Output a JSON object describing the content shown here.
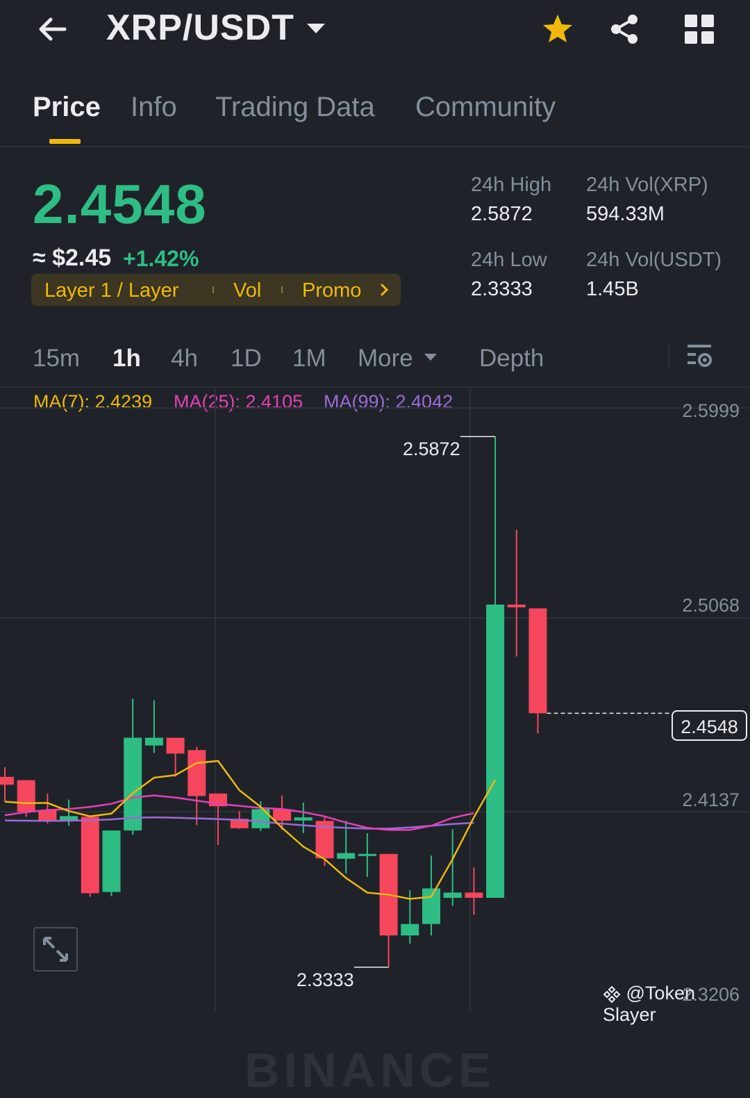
{
  "header": {
    "pair": "XRP/USDT",
    "icons": [
      "back-arrow-icon",
      "caret-down-icon",
      "star-icon",
      "share-icon",
      "grid-icon"
    ]
  },
  "tabs": [
    {
      "label": "Price",
      "active": true
    },
    {
      "label": "Info"
    },
    {
      "label": "Trading Data"
    },
    {
      "label": "Community"
    }
  ],
  "ticker": {
    "price": "2.4548",
    "usd": "≈ $2.45",
    "change": "+1.42%",
    "tags": [
      "Layer 1 / Layer",
      "Vol",
      "Promo"
    ],
    "stats": {
      "high_label": "24h High",
      "high": "2.5872",
      "low_label": "24h Low",
      "low": "2.3333",
      "vol_xrp_label": "24h Vol(XRP)",
      "vol_xrp": "594.33M",
      "vol_usdt_label": "24h Vol(USDT)",
      "vol_usdt": "1.45B"
    }
  },
  "intervals": {
    "items": [
      "15m",
      "1h",
      "4h",
      "1D",
      "1M",
      "More",
      "Depth"
    ],
    "active": "1h"
  },
  "indicators": {
    "ma7": "MA(7): 2.4239",
    "ma25": "MA(25): 2.4105",
    "ma99": "MA(99): 2.4042"
  },
  "colors": {
    "up": "#2ebd85",
    "down": "#f6465d",
    "accent": "#f0b90b",
    "ma7": "#f0b90b",
    "ma25": "#e440b6",
    "ma99": "#9c6ad8"
  },
  "chart_data": {
    "type": "candlestick",
    "y_axis_labels": [
      "2.5999",
      "2.5068",
      "2.4137",
      "2.3206"
    ],
    "ylim": [
      2.3206,
      2.5999
    ],
    "current_price": "2.4548",
    "high_marker": "2.5872",
    "low_marker": "2.3333",
    "watermark": "BINANCE",
    "candles": [
      {
        "o": 2.4244,
        "c": 2.4206,
        "h": 2.429,
        "l": 2.4125
      },
      {
        "o": 2.4228,
        "c": 2.4076,
        "h": 2.4228,
        "l": 2.4053
      },
      {
        "o": 2.4086,
        "c": 2.4033,
        "h": 2.4164,
        "l": 2.402
      },
      {
        "o": 2.4033,
        "c": 2.4056,
        "h": 2.4135,
        "l": 2.401
      },
      {
        "o": 2.4053,
        "c": 2.3687,
        "h": 2.4053,
        "l": 2.367
      },
      {
        "o": 2.3693,
        "c": 2.3987,
        "h": 2.3987,
        "l": 2.3673
      },
      {
        "o": 2.3987,
        "c": 2.4431,
        "h": 2.4617,
        "l": 2.3967
      },
      {
        "o": 2.4394,
        "c": 2.4431,
        "h": 2.461,
        "l": 2.4358
      },
      {
        "o": 2.4431,
        "c": 2.4355,
        "h": 2.4431,
        "l": 2.4244
      },
      {
        "o": 2.4372,
        "c": 2.4152,
        "h": 2.4387,
        "l": 2.4013
      },
      {
        "o": 2.4164,
        "c": 2.4103,
        "h": 2.4164,
        "l": 2.3918
      },
      {
        "o": 2.4043,
        "c": 2.3998,
        "h": 2.408,
        "l": 2.3995
      },
      {
        "o": 2.3998,
        "c": 2.4089,
        "h": 2.4127,
        "l": 2.3985
      },
      {
        "o": 2.4089,
        "c": 2.4034,
        "h": 2.4154,
        "l": 2.399
      },
      {
        "o": 2.4035,
        "c": 2.405,
        "h": 2.4121,
        "l": 2.3975
      },
      {
        "o": 2.4033,
        "c": 2.3854,
        "h": 2.4055,
        "l": 2.3817
      },
      {
        "o": 2.3852,
        "c": 2.3879,
        "h": 2.4033,
        "l": 2.3782
      },
      {
        "o": 2.3875,
        "c": 2.3875,
        "h": 2.3974,
        "l": 2.3765
      },
      {
        "o": 2.3875,
        "c": 2.3485,
        "h": 2.3875,
        "l": 2.3333
      },
      {
        "o": 2.3485,
        "c": 2.354,
        "h": 2.3701,
        "l": 2.3446
      },
      {
        "o": 2.354,
        "c": 2.371,
        "h": 2.3867,
        "l": 2.3485
      },
      {
        "o": 2.3665,
        "c": 2.369,
        "h": 2.3993,
        "l": 2.3626
      },
      {
        "o": 2.369,
        "c": 2.3665,
        "h": 2.381,
        "l": 2.3584
      },
      {
        "o": 2.3665,
        "c": 2.5068,
        "h": 2.5872,
        "l": 2.3665
      },
      {
        "o": 2.5068,
        "c": 2.5055,
        "h": 2.5426,
        "l": 2.482
      },
      {
        "o": 2.505,
        "c": 2.4548,
        "h": 2.505,
        "l": 2.4452
      }
    ],
    "ma7": [
      2.4125,
      2.4118,
      2.4119,
      2.408,
      2.4055,
      2.4068,
      2.4165,
      2.424,
      2.4252,
      2.431,
      2.432,
      2.418,
      2.41,
      2.4,
      2.391,
      2.385,
      2.376,
      2.369,
      2.368,
      2.366,
      2.367,
      2.385,
      2.405,
      2.423
    ],
    "ma25": [
      2.406,
      2.4075,
      2.4085,
      2.409,
      2.41,
      2.4115,
      2.4145,
      2.4155,
      2.4145,
      2.413,
      2.4115,
      2.4105,
      2.4095,
      2.409,
      2.4075,
      2.4055,
      2.4025,
      2.4,
      2.399,
      2.399,
      2.401,
      2.4048,
      2.407
    ],
    "ma99": [
      2.4035,
      2.4034,
      2.4033,
      2.4034,
      2.4036,
      2.404,
      2.4048,
      2.405,
      2.4048,
      2.4045,
      2.4042,
      2.4038,
      2.403,
      2.402,
      2.4012,
      2.4005,
      2.4,
      2.3996,
      2.3996,
      2.4002,
      2.401,
      2.4018,
      2.4024
    ]
  },
  "credit": "@Token Slayer"
}
